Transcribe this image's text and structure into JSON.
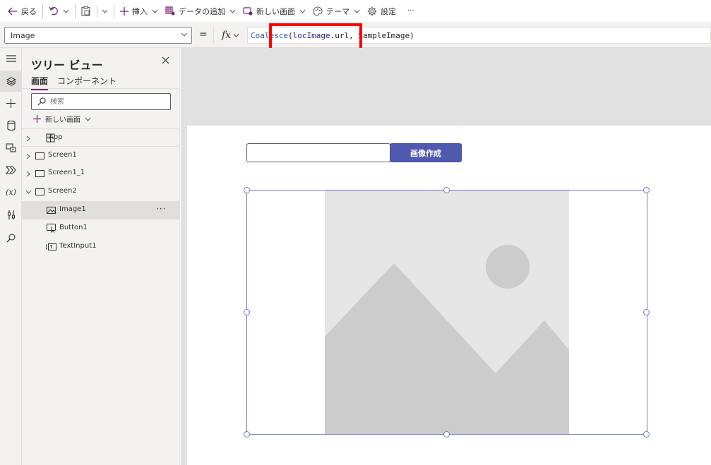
{
  "command_bar": {
    "back": "戻る",
    "insert": "挿入",
    "add_data": "データの追加",
    "new_screen": "新しい画面",
    "theme": "テーマ",
    "settings": "設定",
    "more": "···"
  },
  "formula_bar": {
    "property": "Image",
    "equals": "=",
    "fx": "fx",
    "formula_fn": "Coalesce",
    "formula_open": "(",
    "formula_var": "locImage",
    "formula_field": ".url, SampleImage)"
  },
  "tree_view": {
    "title": "ツリー ビュー",
    "tabs": [
      "画面",
      "コンポーネント"
    ],
    "search_placeholder": "検索",
    "new_screen": "新しい画面",
    "items": [
      {
        "label": "App",
        "kind": "app"
      },
      {
        "label": "Screen1",
        "kind": "screen"
      },
      {
        "label": "Screen1_1",
        "kind": "screen"
      },
      {
        "label": "Screen2",
        "kind": "screen"
      },
      {
        "label": "Image1",
        "kind": "image"
      },
      {
        "label": "Button1",
        "kind": "button"
      },
      {
        "label": "TextInput1",
        "kind": "textinput"
      }
    ],
    "selected_more": "···"
  },
  "canvas": {
    "button_label": "画像作成",
    "text_input_value": ""
  },
  "colors": {
    "accent": "#742774",
    "button": "#4f5aaf",
    "selection": "#6f7ac8",
    "highlight": "#ff0000"
  }
}
